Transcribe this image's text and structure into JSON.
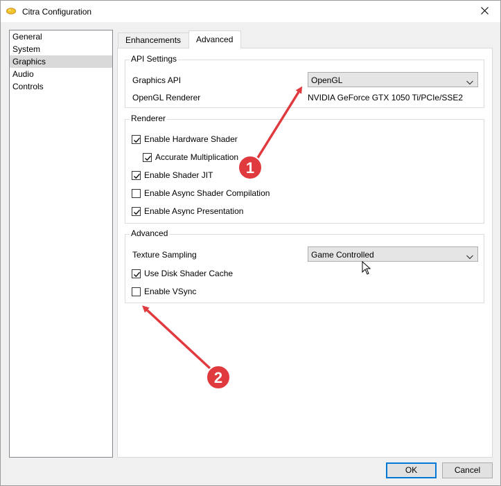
{
  "window": {
    "title": "Citra Configuration"
  },
  "sidebar": {
    "items": [
      {
        "label": "General"
      },
      {
        "label": "System"
      },
      {
        "label": "Graphics",
        "selected": true
      },
      {
        "label": "Audio"
      },
      {
        "label": "Controls"
      }
    ]
  },
  "tabs": [
    {
      "label": "Enhancements"
    },
    {
      "label": "Advanced",
      "active": true
    }
  ],
  "api_settings": {
    "title": "API Settings",
    "graphics_api_label": "Graphics API",
    "graphics_api_value": "OpenGL",
    "renderer_label": "OpenGL Renderer",
    "renderer_value": "NVIDIA GeForce GTX 1050 Ti/PCIe/SSE2"
  },
  "renderer": {
    "title": "Renderer",
    "options": [
      {
        "label": "Enable Hardware Shader",
        "checked": true
      },
      {
        "label": "Accurate Multiplication",
        "checked": true
      },
      {
        "label": "Enable Shader JIT",
        "checked": true
      },
      {
        "label": "Enable Async Shader Compilation",
        "checked": false
      },
      {
        "label": "Enable Async Presentation",
        "checked": true
      }
    ]
  },
  "advanced": {
    "title": "Advanced",
    "texture_sampling_label": "Texture Sampling",
    "texture_sampling_value": "Game Controlled",
    "options": [
      {
        "label": "Use Disk Shader Cache",
        "checked": true
      },
      {
        "label": "Enable VSync",
        "checked": false
      }
    ]
  },
  "footer": {
    "ok_label": "OK",
    "cancel_label": "Cancel"
  },
  "annotations": {
    "color": "#e0393e",
    "badges": [
      {
        "text": "1"
      },
      {
        "text": "2"
      }
    ]
  }
}
